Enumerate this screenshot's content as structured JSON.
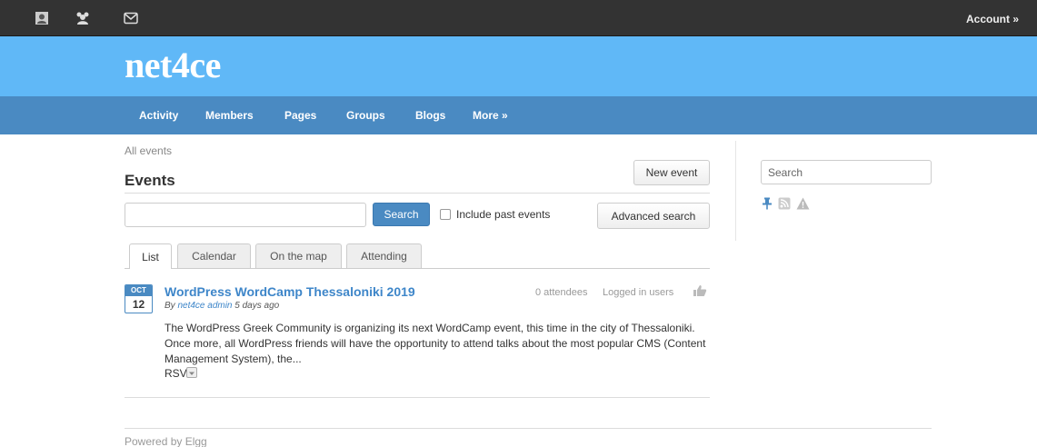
{
  "topbar": {
    "icons": [
      "profile-icon",
      "friends-icon",
      "messages-icon"
    ],
    "account_label": "Account »"
  },
  "site": {
    "name": "net4ce"
  },
  "nav": {
    "items": [
      {
        "label": "Activity"
      },
      {
        "label": "Members"
      },
      {
        "label": "Pages"
      },
      {
        "label": "Groups"
      },
      {
        "label": "Blogs"
      },
      {
        "label": "More »"
      }
    ]
  },
  "main": {
    "breadcrumb": "All events",
    "title": "Events",
    "new_event_label": "New event",
    "search_button_label": "Search",
    "include_past_label": "Include past events",
    "include_past_checked": false,
    "advanced_search_label": "Advanced search",
    "tabs": [
      {
        "label": "List",
        "active": true
      },
      {
        "label": "Calendar",
        "active": false
      },
      {
        "label": "On the map",
        "active": false
      },
      {
        "label": "Attending",
        "active": false
      }
    ],
    "events": [
      {
        "month": "OCT",
        "day": "12",
        "title": "WordPress WordCamp Thessaloniki 2019",
        "by_prefix": "By",
        "author": "net4ce admin",
        "time_ago": "5 days ago",
        "attendees": "0 attendees",
        "access": "Logged in users",
        "description": "The WordPress Greek Community is organizing its next WordCamp event, this time in the city of Thessaloniki. Once more, all WordPress friends will have the opportunity to attend talks about the most popular CMS (Content Management System), the...",
        "rsvp_label": "RSVP"
      }
    ]
  },
  "sidebar": {
    "search_placeholder": "Search",
    "icons": [
      "pin-icon",
      "rss-icon",
      "report-icon"
    ]
  },
  "footer": {
    "text": "Powered by Elgg"
  },
  "colors": {
    "topbar": "#333333",
    "banner": "#60b8f7",
    "nav": "#4a8ac2",
    "link": "#3e86c9"
  }
}
